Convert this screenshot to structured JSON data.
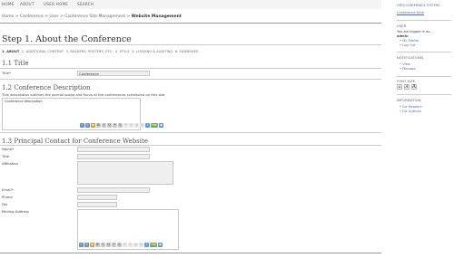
{
  "nav": {
    "items": [
      "HOME",
      "ABOUT",
      "USER HOME",
      "SEARCH"
    ]
  },
  "breadcrumb": {
    "items": [
      "Home",
      "Conference",
      "User",
      "Conference Site Management"
    ],
    "current": "Website Management",
    "separator": ">"
  },
  "page": {
    "title": "Step 1. About the Conference",
    "steps": [
      {
        "num": "1.",
        "label": "ABOUT",
        "active": true
      },
      {
        "num": "2.",
        "label": "ADDITIONAL CONTENT",
        "active": false
      },
      {
        "num": "3.",
        "label": "READERS, POSTERS, ETC.",
        "active": false
      },
      {
        "num": "4.",
        "label": "STYLE",
        "active": false
      },
      {
        "num": "5.",
        "label": "LOGGING & AUDITING",
        "active": false
      },
      {
        "num": "6.",
        "label": "SIDEBOXES",
        "active": false
      }
    ]
  },
  "sections": {
    "title": {
      "heading": "1.1 Title",
      "label": "Title*",
      "value": "Conference"
    },
    "description": {
      "heading": "1.2 Conference Description",
      "help": "This description outlines the overall scope and focus of the conferences scheduled on this site.",
      "value": "Conference description"
    },
    "contact": {
      "heading": "1.3 Principal Contact for Conference Website",
      "labels": {
        "name": "Name*",
        "title": "Title",
        "affiliation": "Affiliation",
        "email": "Email*",
        "phone": "Phone",
        "fax": "Fax",
        "mailing": "Mailing Address"
      }
    }
  },
  "toolbar": {
    "buttons": [
      "cut",
      "copy",
      "paste",
      "bold",
      "italic",
      "underline",
      "bullet-list",
      "numbered-list",
      "undo",
      "redo",
      "link",
      "unlink",
      "help",
      "html",
      "image"
    ],
    "glyphs": [
      "✂",
      "⎘",
      "📋",
      "B",
      "I",
      "U",
      "•",
      "1.",
      "↶",
      "↷",
      "◎",
      "⊘",
      "?",
      "HTML",
      "▣"
    ]
  },
  "sidebar": {
    "system_link": "OPEN CONFERENCE SYSTEMS",
    "help_link": "Conference Help",
    "user": {
      "heading": "USER",
      "logged_in_as": "You are logged in as...",
      "username": "admin",
      "links": [
        "My Profile",
        "Log Out"
      ]
    },
    "notifications": {
      "heading": "NOTIFICATIONS",
      "links": [
        "View",
        "Manage"
      ]
    },
    "font_size": {
      "heading": "FONT SIZE",
      "buttons": [
        "A",
        "A",
        "A"
      ]
    },
    "information": {
      "heading": "INFORMATION",
      "links": [
        "For Readers",
        "For Authors"
      ]
    }
  }
}
